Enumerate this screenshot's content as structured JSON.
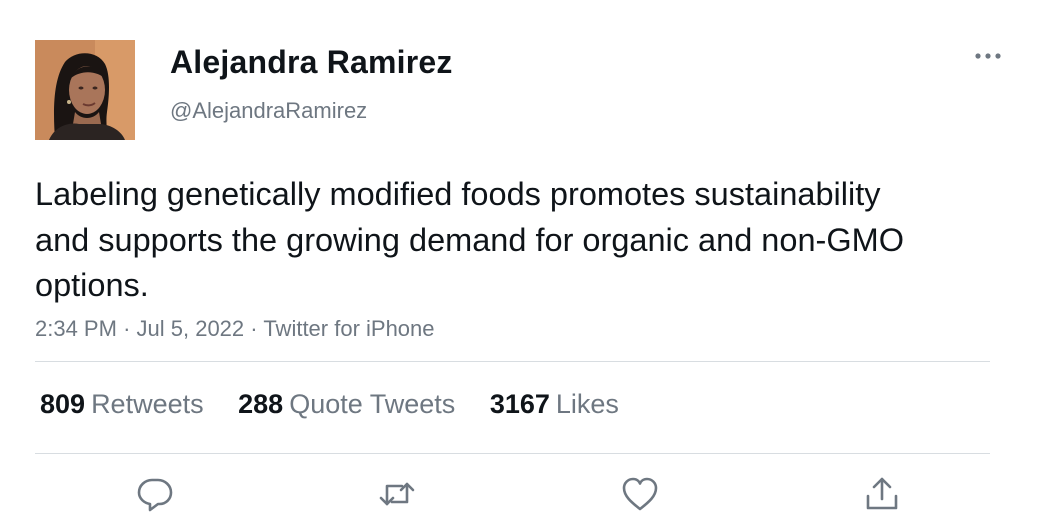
{
  "author": {
    "display_name": "Alejandra Ramirez",
    "handle": "@AlejandraRamirez",
    "avatar_icon": "profile-photo"
  },
  "tweet": {
    "text": "Labeling genetically modified foods promotes sustainability and supports the growing demand for organic and non-GMO options.",
    "time": "2:34 PM",
    "separator": "·",
    "date": "Jul 5, 2022",
    "source": "Twitter for iPhone"
  },
  "stats": {
    "retweets": {
      "count": "809",
      "label": "Retweets"
    },
    "quote_tweets": {
      "count": "288",
      "label": "Quote Tweets"
    },
    "likes": {
      "count": "3167",
      "label": "Likes"
    }
  },
  "actions": {
    "reply_icon": "reply-icon",
    "retweet_icon": "retweet-icon",
    "like_icon": "heart-icon",
    "share_icon": "share-icon",
    "more_icon": "more-icon"
  },
  "colors": {
    "text_primary": "#0f1419",
    "text_secondary": "#6e7781",
    "divider": "#d8dde1",
    "icon": "#6e7781"
  }
}
